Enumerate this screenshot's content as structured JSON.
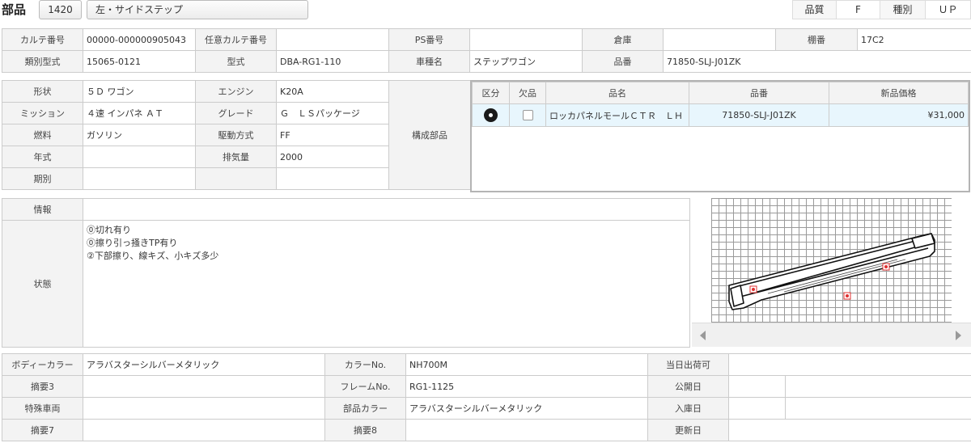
{
  "header": {
    "title": "部品",
    "part_code": "1420",
    "part_name": "左・サイドステップ",
    "quality_label": "品質",
    "quality_value": "F",
    "type_label": "種別",
    "type_value": "ＵＰ"
  },
  "row1": {
    "karte_label": "カルテ番号",
    "karte_value": "00000-000000905043",
    "optional_karte_label": "任意カルテ番号",
    "optional_karte_value": "",
    "ps_label": "PS番号",
    "ps_value": "",
    "warehouse_label": "倉庫",
    "warehouse_value": "",
    "shelf_label": "棚番",
    "shelf_value": "17C2"
  },
  "row2": {
    "model_class_label": "類別型式",
    "model_class_value": "15065-0121",
    "model_label": "型式",
    "model_value": "DBA-RG1-110",
    "car_name_label": "車種名",
    "car_name_value": "ステップワゴン",
    "part_no_label": "品番",
    "part_no_value": "71850-SLJ-J01ZK"
  },
  "specs": {
    "shape_label": "形状",
    "shape_value": "５Ｄ ワゴン",
    "engine_label": "エンジン",
    "engine_value": "K20A",
    "mission_label": "ミッション",
    "mission_value": "４速 インパネ ＡＴ",
    "grade_label": "グレード",
    "grade_value": "Ｇ　ＬＳパッケージ",
    "fuel_label": "燃料",
    "fuel_value": "ガソリン",
    "drive_label": "駆動方式",
    "drive_value": "FF",
    "year_label": "年式",
    "year_value": "",
    "displacement_label": "排気量",
    "displacement_value": "2000",
    "period_label": "期別",
    "period_value": "",
    "components_label": "構成部品"
  },
  "parts_table": {
    "headers": [
      "区分",
      "欠品",
      "品名",
      "品番",
      "新品価格"
    ],
    "rows": [
      {
        "category_icon": "cd-disc-icon",
        "missing": false,
        "name": "ロッカパネルモールＣＴＲ　ＬＨ",
        "part_no": "71850-SLJ-J01ZK",
        "price": "¥31,000"
      }
    ]
  },
  "info": {
    "info_label": "情報",
    "info_value": "",
    "state_label": "状態",
    "state_lines": [
      "⓪切れ有り",
      "⓪擦り引っ掻きTP有り",
      "②下部擦り、線キズ、小キズ多少"
    ]
  },
  "bottom": {
    "body_color_label": "ボディーカラー",
    "body_color_value": "アラバスターシルバーメタリック",
    "color_no_label": "カラーNo.",
    "color_no_value": "NH700M",
    "ship_today_label": "当日出荷可",
    "ship_today_value": "",
    "summary3_label": "摘要3",
    "summary3_value": "",
    "frame_no_label": "フレームNo.",
    "frame_no_value": "RG1-1125",
    "public_date_label": "公開日",
    "public_date_value": "",
    "special_vehicle_label": "特殊車両",
    "special_vehicle_value": "",
    "part_color_label": "部品カラー",
    "part_color_value": "アラバスターシルバーメタリック",
    "stock_date_label": "入庫日",
    "stock_date_value": "",
    "summary7_label": "摘要7",
    "summary7_value": "",
    "summary8_label": "摘要8",
    "summary8_value": "",
    "update_date_label": "更新日",
    "update_date_value": ""
  },
  "colors": {
    "label_bg": "#f3f3f3",
    "border": "#cccccc",
    "selected_row": "#e8f6fd",
    "damage_mark": "#e03030"
  }
}
